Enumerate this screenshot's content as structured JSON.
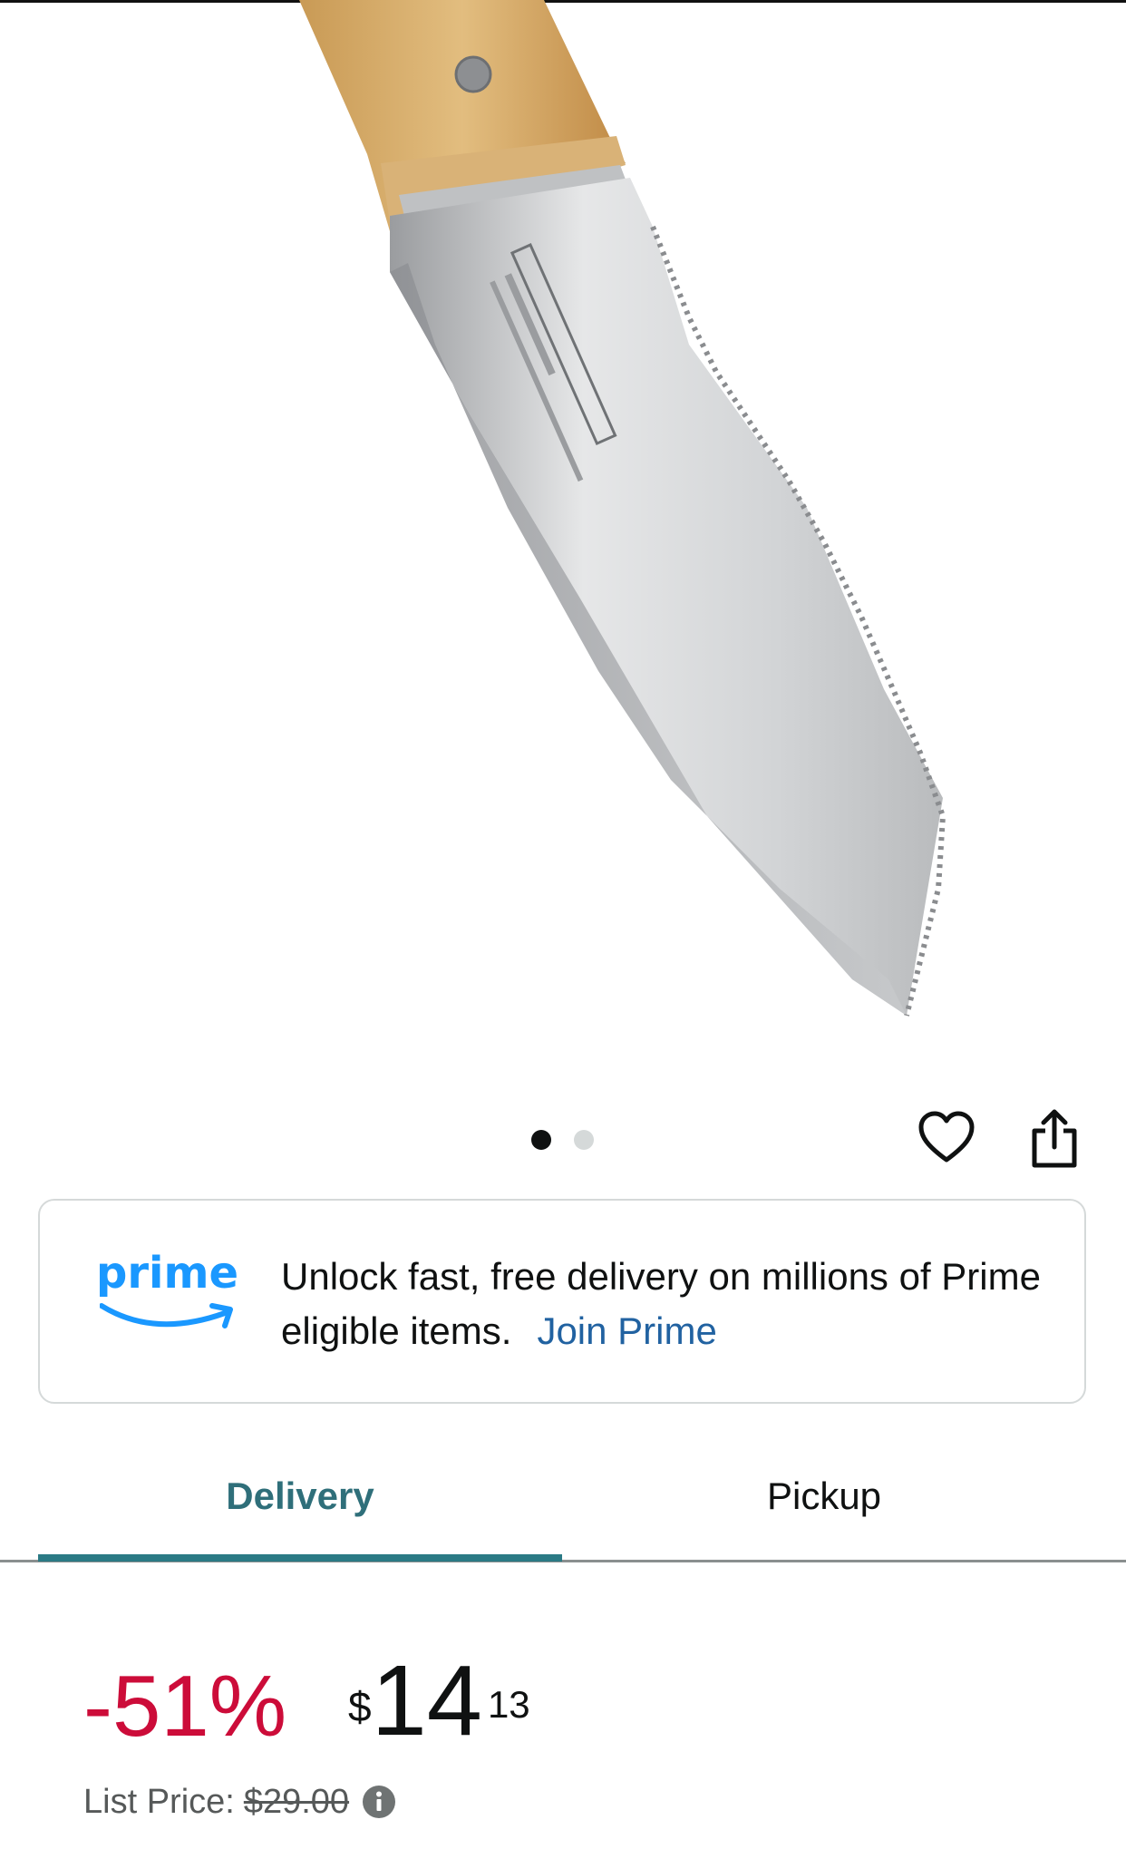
{
  "product_image": {
    "alt": "Japanese hori hori garden knife with wooden handle"
  },
  "carousel": {
    "total": 2,
    "active": 1
  },
  "actions": {
    "heart_icon": "heart-icon",
    "share_icon": "share-icon"
  },
  "prime_banner": {
    "logo_text": "prime",
    "message": "Unlock fast, free delivery on millions of Prime eligible items.",
    "link": "Join Prime"
  },
  "tabs": [
    {
      "label": "Delivery",
      "selected": true
    },
    {
      "label": "Pickup",
      "selected": false
    }
  ],
  "pricing": {
    "discount": "-51%",
    "currency": "$",
    "whole": "14",
    "fraction": "13",
    "list_label": "List Price:",
    "list_value": "$29.00"
  },
  "colors": {
    "accent_tab": "#2b7a85",
    "discount": "#cc0c39",
    "prime_blue": "#1a98ff",
    "link": "#2162a1"
  }
}
